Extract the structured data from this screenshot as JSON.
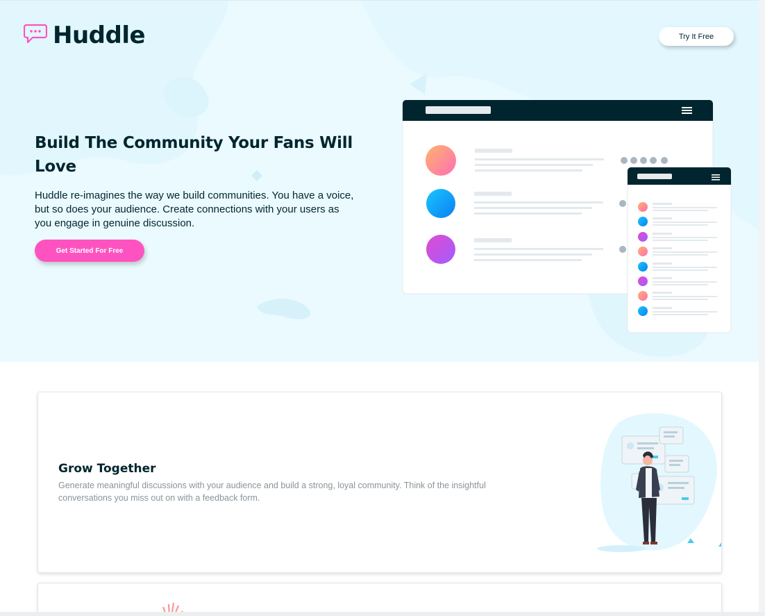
{
  "header": {
    "logo_text": "Huddle",
    "logo_icon": "chat-bubble-icon",
    "cta_label": "Try It Free"
  },
  "hero": {
    "title": "Build The Community Your Fans Will Love",
    "description": "Huddle re-imagines the way we build communities. You have a voice, but so does your audience. Create connections with your users as you engage in genuine discussion.",
    "cta_label": "Get Started For Free"
  },
  "features": [
    {
      "title": "Grow Together",
      "description": "Generate meaningful discussions with your audience and build a strong, loyal community. Think of the insightful conversations you miss out on with a feedback form."
    }
  ],
  "colors": {
    "brand_dark": "#00252e",
    "accent_pink": "#ff52c1",
    "hero_bg": "#eafaff"
  }
}
